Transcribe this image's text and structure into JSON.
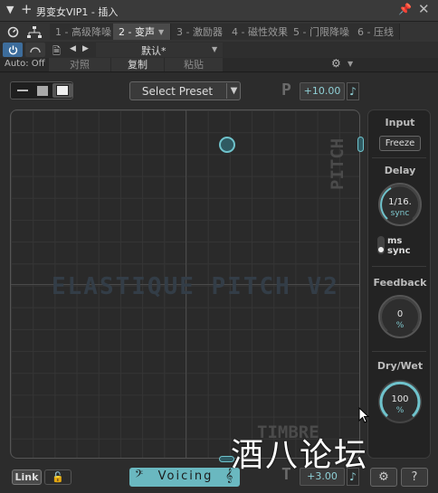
{
  "window": {
    "title": "男变女VIP1 - 插入"
  },
  "fx_tabs": [
    {
      "label": "1 - 高级降噪",
      "active": false
    },
    {
      "label": "2 - 变声",
      "active": true
    },
    {
      "label": "3 - 激励器",
      "active": false
    },
    {
      "label": "4 - 磁性效果",
      "active": false
    },
    {
      "label": "5 - 门限降噪",
      "active": false
    },
    {
      "label": "6 - 压线",
      "active": false
    }
  ],
  "toolbar": {
    "preset_name": "默认*",
    "auto_label": "Auto: Off",
    "compare_label": "对照",
    "copy_label": "复制",
    "paste_label": "粘贴"
  },
  "plugin": {
    "preset_button": "Select Preset",
    "pitch_letter": "P",
    "pitch_value": "+10.00",
    "timbre_letter": "T",
    "timbre_value": "+3.00",
    "pad_watermark": "ELASTIQUE PITCH V2",
    "pad_pitch_label": "PITCH",
    "pad_timbre_label": "TIMBRE",
    "pad_position": {
      "pitch": 0.82,
      "timbre": 0.62
    },
    "link_label": "Link",
    "voicing_label": "Voicing",
    "accent_color": "#6ab8c0"
  },
  "side": {
    "input_label": "Input",
    "freeze_label": "Freeze",
    "delay_label": "Delay",
    "delay_value": "1/16.",
    "delay_unit": "sync",
    "ms_option": "ms",
    "sync_option": "sync",
    "feedback_label": "Feedback",
    "feedback_value": "0",
    "feedback_unit": "%",
    "drywet_label": "Dry/Wet",
    "drywet_value": "100",
    "drywet_unit": "%"
  },
  "overlay": {
    "watermark_text": "酒八论坛"
  }
}
